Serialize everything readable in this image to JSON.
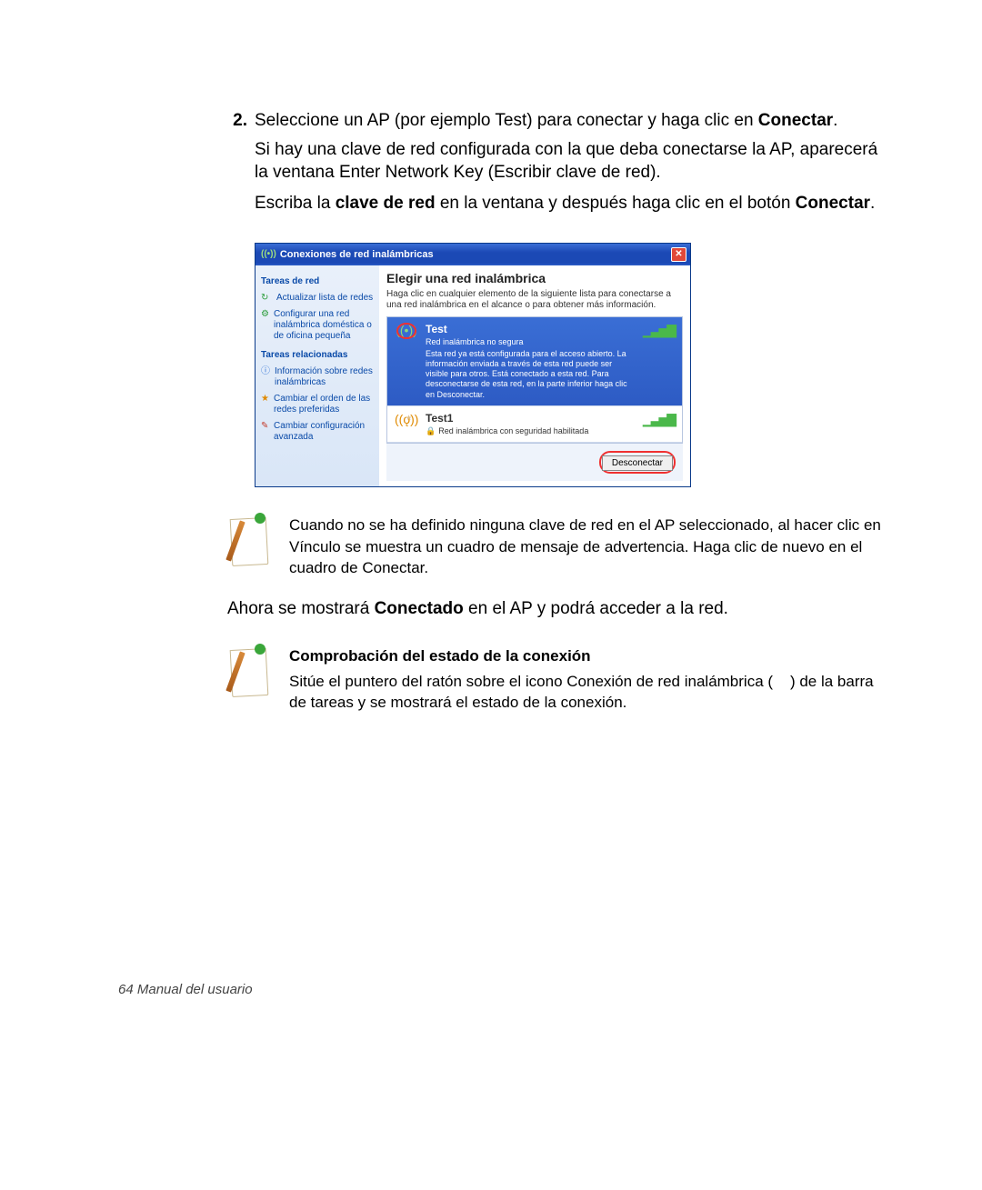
{
  "step": {
    "number": "2.",
    "line1_a": "Seleccione un AP (por ejemplo Test) para conectar y haga clic en ",
    "line1_b": "Conectar",
    "line1_c": ".",
    "para2": "Si hay una clave de red configurada con la que deba conectarse la AP, aparecerá la ventana Enter Network Key (Escribir clave de red).",
    "para3_a": "Escriba la ",
    "para3_b": "clave de red",
    "para3_c": " en la ventana y después haga clic en el botón ",
    "para3_d": "Conectar",
    "para3_e": "."
  },
  "dialog": {
    "title": "Conexiones de red inalámbricas",
    "sidebar": {
      "section1": "Tareas de red",
      "item1": "Actualizar lista de redes",
      "item2": "Configurar una red inalámbrica doméstica o de oficina pequeña",
      "section2": "Tareas relacionadas",
      "item3": "Información sobre redes inalámbricas",
      "item4": "Cambiar el orden de las redes preferidas",
      "item5": "Cambiar configuración avanzada"
    },
    "main": {
      "title": "Elegir una red inalámbrica",
      "desc": "Haga clic en cualquier elemento de la siguiente lista para conectarse a una red inalámbrica en el alcance o para obtener más información.",
      "net1": {
        "name": "Test",
        "sub": "Red inalámbrica no segura",
        "detail": "Esta red ya está configurada para el acceso abierto. La información enviada a través de esta red puede ser visible para otros. Está conectado a esta red. Para desconectarse de esta red, en la parte inferior haga clic en Desconectar."
      },
      "net2": {
        "name": "Test1",
        "sub": "Red inalámbrica con seguridad habilitada"
      }
    },
    "button": "Desconectar"
  },
  "note1": "Cuando no se ha definido ninguna clave de red en el AP seleccionado, al hacer clic en Vínculo se muestra un cuadro de mensaje de advertencia. Haga clic de nuevo en el cuadro de Conectar.",
  "body2_a": "Ahora se mostrará ",
  "body2_b": "Conectado",
  "body2_c": " en el AP y podrá acceder a la red.",
  "note2": {
    "heading": "Comprobación del estado de la conexión",
    "text_a": "Sitúe el puntero del ratón sobre el icono Conexión de red inalámbrica (",
    "text_b": ") de la barra de tareas y se mostrará el estado de la conexión."
  },
  "footer": "64  Manual del usuario"
}
